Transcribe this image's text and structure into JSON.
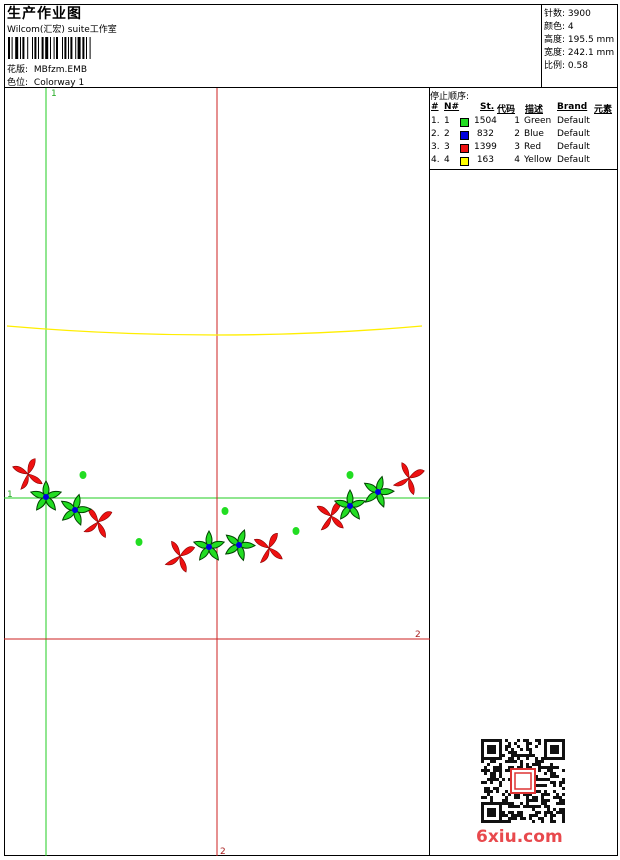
{
  "header": {
    "title": "生产作业图",
    "company": "Wilcom(汇宏) suite工作室",
    "design_label": "花版:",
    "design_value": "MBfzm.EMB",
    "colorway_label": "色位:",
    "colorway_value": "Colorway 1"
  },
  "stats": [
    {
      "label": "针数:",
      "value": "3900"
    },
    {
      "label": "颜色:",
      "value": "4"
    },
    {
      "label": "高度:",
      "value": "195.5 mm"
    },
    {
      "label": "宽度:",
      "value": "242.1 mm"
    },
    {
      "label": "比例:",
      "value": "0.58"
    }
  ],
  "stop_sequence": {
    "title": "停止顺序:",
    "headers": [
      "#",
      "N#",
      "St.",
      "代码",
      "描述",
      "Brand",
      "元素"
    ],
    "rows": [
      {
        "idx": "1.",
        "n": "1",
        "color": "#22dd22",
        "st": "1504",
        "code": "1",
        "desc": "Green",
        "brand": "Default"
      },
      {
        "idx": "2.",
        "n": "2",
        "color": "#0000dd",
        "st": "832",
        "code": "2",
        "desc": "Blue",
        "brand": "Default"
      },
      {
        "idx": "3.",
        "n": "3",
        "color": "#ee1111",
        "st": "1399",
        "code": "3",
        "desc": "Red",
        "brand": "Default"
      },
      {
        "idx": "4.",
        "n": "4",
        "color": "#ffff00",
        "st": "163",
        "code": "4",
        "desc": "Yellow",
        "brand": "Default"
      }
    ]
  },
  "guides": {
    "v1_label": "1",
    "h1_label": "1",
    "h2_label": "2",
    "v2_label": "2"
  },
  "watermark": {
    "logo_text": "6xiu.com",
    "seal_text": "绣花"
  }
}
